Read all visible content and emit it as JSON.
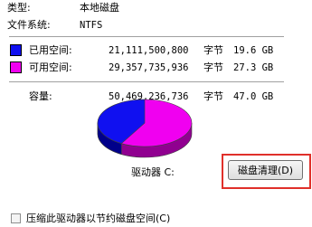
{
  "properties": {
    "type_label": "类型:",
    "type_value": "本地磁盘",
    "fs_label": "文件系统:",
    "fs_value": "NTFS"
  },
  "usage": {
    "used": {
      "label": "已用空间:",
      "bytes": "21,111,500,800",
      "unit": "字节",
      "size": "19.6 GB",
      "color": "#1010f0"
    },
    "free": {
      "label": "可用空间:",
      "bytes": "29,357,735,936",
      "unit": "字节",
      "size": "27.3 GB",
      "color": "#f000f0"
    },
    "capacity": {
      "label": "容量:",
      "bytes": "50,469,236,736",
      "unit": "字节",
      "size": "47.0 GB"
    }
  },
  "pie": {
    "used_fraction": 0.418,
    "used_color": "#1010f0",
    "free_color": "#f000f0",
    "used_shadow": "#00008a",
    "free_shadow": "#900090"
  },
  "drive": {
    "label": "驱动器 C:"
  },
  "cleanup_button": {
    "label": "磁盘清理(D)"
  },
  "compress": {
    "label": "压缩此驱动器以节约磁盘空间(C)"
  }
}
